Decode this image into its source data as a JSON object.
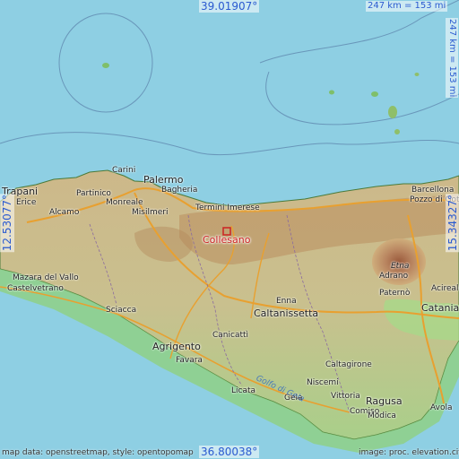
{
  "map": {
    "marker": {
      "name": "Collesano",
      "color": "#cc2222"
    },
    "coords": {
      "north": "39.01907°",
      "south": "36.80038°",
      "west": "12.53077°",
      "east": "15.34327°"
    },
    "scale": {
      "horizontal": "247 km = 153 mi",
      "vertical": "247 km = 153 mi"
    },
    "places": [
      "Carini",
      "Palermo",
      "Bagheria",
      "Trapani",
      "Partinico",
      "Erice",
      "Monreale",
      "Alcamo",
      "Misilmeri",
      "Termini Imerese",
      "Barcellona",
      "Pozzo di Gotto",
      "Mazara del Vallo",
      "Castelvetrano",
      "Etna",
      "Adrano",
      "Paternò",
      "Acireale",
      "Catania",
      "Enna",
      "Caltanissetta",
      "Sciacca",
      "Canicattì",
      "Agrigento",
      "Favara",
      "Caltagirone",
      "Niscemi",
      "Licata",
      "Gela",
      "Vittoria",
      "Ragusa",
      "Comiso",
      "Modica",
      "Avola"
    ],
    "sea_label": "Golfo di Gela",
    "attribution_left": "map data: openstreetmap, style: opentopomap",
    "attribution_right": "image: proc. elevation.city"
  }
}
